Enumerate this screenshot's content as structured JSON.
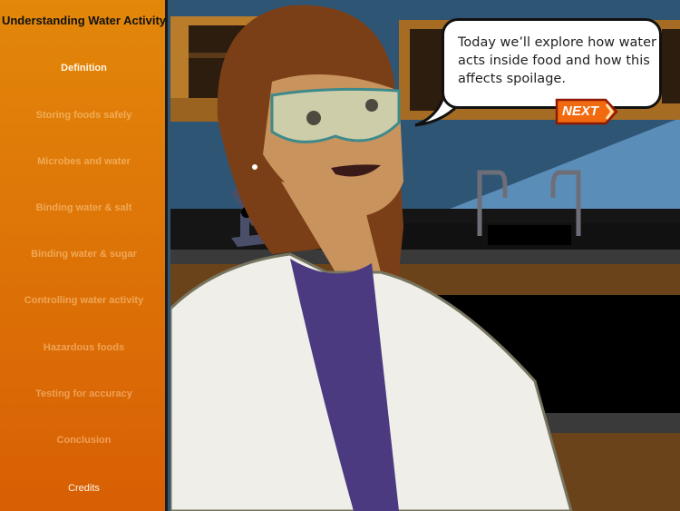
{
  "sidebar": {
    "title": "Understanding Water Activity",
    "items": [
      {
        "label": "Definition",
        "state": "active"
      },
      {
        "label": "Storing foods safely",
        "state": "disabled"
      },
      {
        "label": "Microbes and water",
        "state": "disabled"
      },
      {
        "label": "Binding water & salt",
        "state": "disabled"
      },
      {
        "label": "Binding water & sugar",
        "state": "disabled"
      },
      {
        "label": "Controlling water activity",
        "state": "disabled"
      },
      {
        "label": "Hazardous foods",
        "state": "disabled"
      },
      {
        "label": "Testing for accuracy",
        "state": "disabled"
      },
      {
        "label": "Conclusion",
        "state": "disabled"
      },
      {
        "label": "Credits",
        "state": "enabled"
      }
    ]
  },
  "dialog": {
    "text": "Today we’ll explore how water acts inside food and how this affects spoilage.",
    "next_label": "NEXT"
  },
  "colors": {
    "sidebar_top": "#e2870a",
    "sidebar_bottom": "#d85f04",
    "next_button": "#f26a10"
  }
}
